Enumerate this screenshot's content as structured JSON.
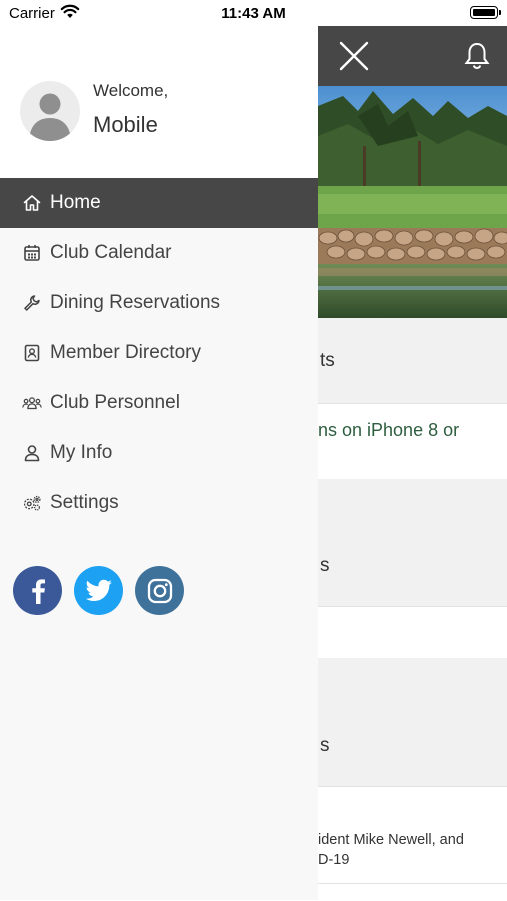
{
  "status_bar": {
    "carrier": "Carrier",
    "time": "11:43 AM"
  },
  "header": {
    "close_icon": "close-icon",
    "bell_icon": "bell-icon",
    "color": "#474747"
  },
  "drawer": {
    "welcome": "Welcome,",
    "username": "Mobile",
    "menu": [
      {
        "label": "Home",
        "icon": "home-icon",
        "active": true
      },
      {
        "label": "Club Calendar",
        "icon": "calendar-icon",
        "active": false
      },
      {
        "label": "Dining Reservations",
        "icon": "wrench-icon",
        "active": false
      },
      {
        "label": "Member Directory",
        "icon": "directory-icon",
        "active": false
      },
      {
        "label": "Club Personnel",
        "icon": "people-icon",
        "active": false
      },
      {
        "label": "My Info",
        "icon": "user-icon",
        "active": false
      },
      {
        "label": "Settings",
        "icon": "gears-icon",
        "active": false
      }
    ],
    "social": [
      {
        "name": "facebook",
        "color": "#3b5998"
      },
      {
        "name": "twitter",
        "color": "#1da1f2"
      },
      {
        "name": "instagram",
        "color": "#3f729b"
      }
    ]
  },
  "background_content": {
    "section1_fragment": "ts",
    "section1_link_fragment": "ns on iPhone 8 or",
    "section2_fragment": "s",
    "section3_fragment": "s",
    "article_line1": "ident Mike Newell, and",
    "article_line2": "D-19"
  }
}
